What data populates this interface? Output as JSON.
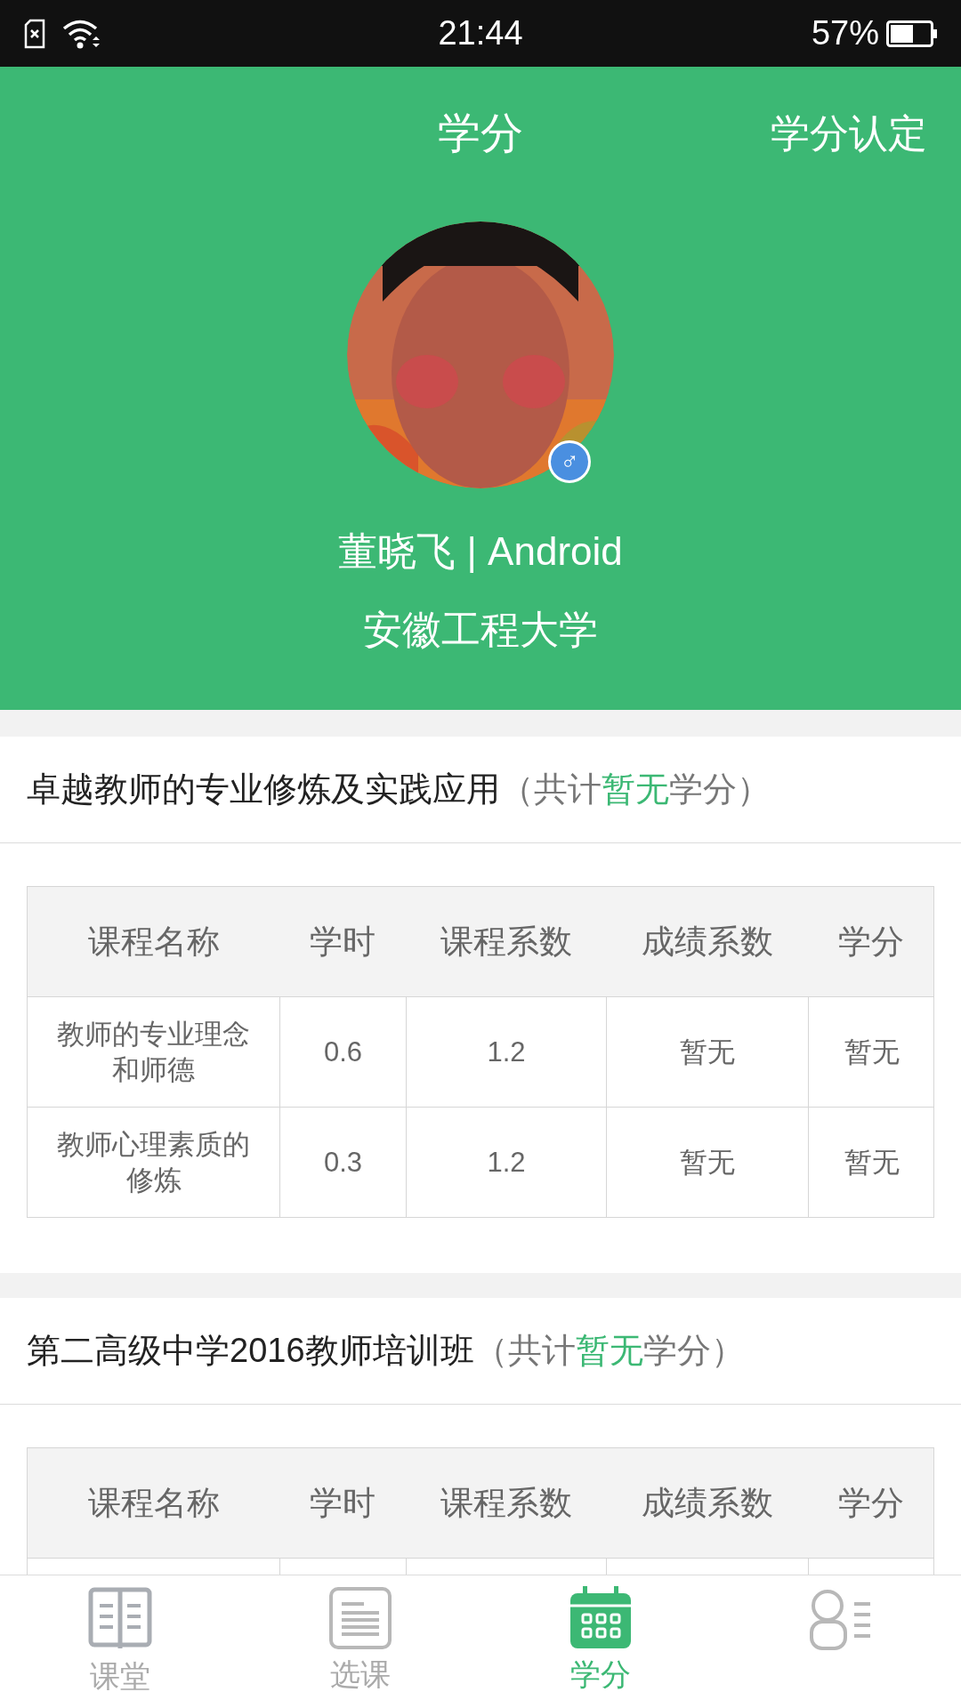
{
  "status_bar": {
    "time": "21:44",
    "battery": "57%"
  },
  "header": {
    "title": "学分",
    "action": "学分认定"
  },
  "profile": {
    "gender": "♂",
    "name_line": "董晓飞 | Android",
    "school": "安徽工程大学"
  },
  "sections": [
    {
      "title": "卓越教师的专业修炼及实践应用",
      "note_prefix": "（共计",
      "note_value": "暂无",
      "note_suffix": "学分）",
      "columns": [
        "课程名称",
        "学时",
        "课程系数",
        "成绩系数",
        "学分"
      ],
      "rows": [
        [
          "教师的专业理念和师德",
          "0.6",
          "1.2",
          "暂无",
          "暂无"
        ],
        [
          "教师心理素质的修炼",
          "0.3",
          "1.2",
          "暂无",
          "暂无"
        ]
      ]
    },
    {
      "title": "第二高级中学2016教师培训班",
      "note_prefix": "（共计",
      "note_value": "暂无",
      "note_suffix": "学分）",
      "columns": [
        "课程名称",
        "学时",
        "课程系数",
        "成绩系数",
        "学分"
      ]
    }
  ],
  "tabs": [
    {
      "kind": "book",
      "label": "课堂",
      "selected": false
    },
    {
      "kind": "list",
      "label": "选课",
      "selected": false
    },
    {
      "kind": "calendar",
      "label": "学分",
      "selected": true
    },
    {
      "kind": "person",
      "selected": false
    }
  ]
}
